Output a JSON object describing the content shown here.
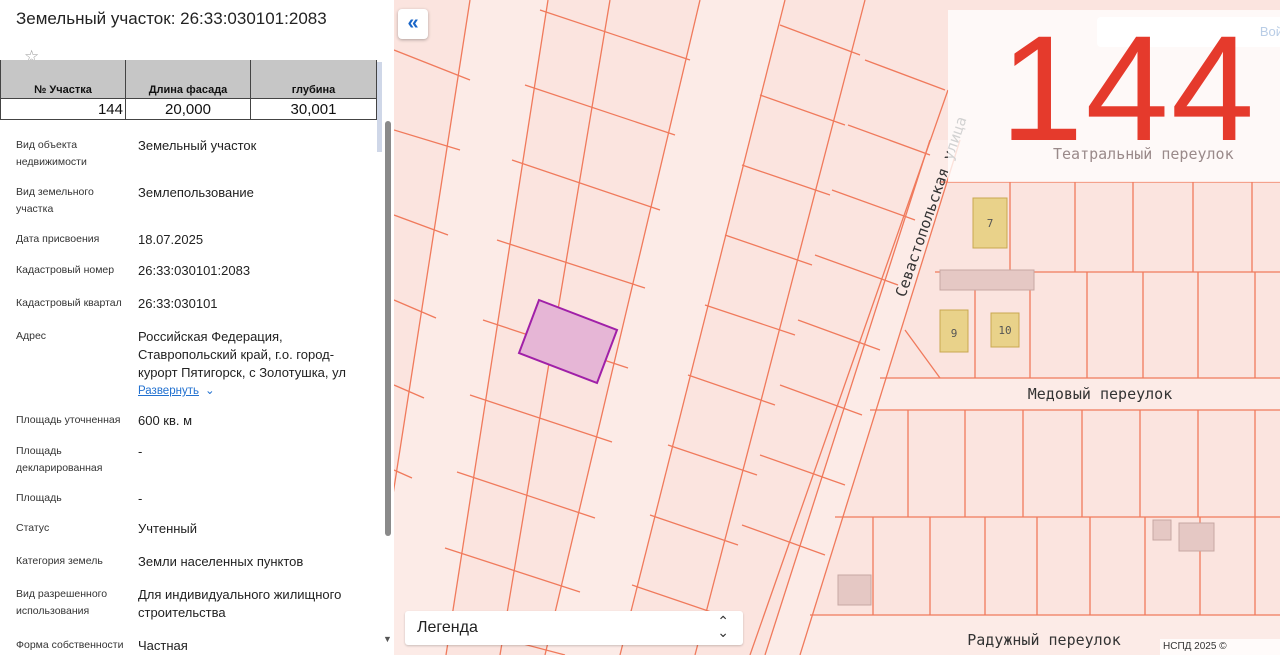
{
  "panel": {
    "title": "Земельный участок: 26:33:030101:2083",
    "favorite_icon": "star-icon",
    "overlay_table": {
      "headers": [
        "№ Участка",
        "Длина фасада",
        "глубина"
      ],
      "row": [
        "144",
        "20,000",
        "30,001"
      ]
    },
    "properties": [
      {
        "label": "Вид объекта недвижимости",
        "value": "Земельный участок"
      },
      {
        "label": "Вид земельного участка",
        "value": "Землепользование"
      },
      {
        "label": "Дата присвоения",
        "value": "18.07.2025"
      },
      {
        "label": "Кадастровый номер",
        "value": "26:33:030101:2083"
      },
      {
        "label": "Кадастровый квартал",
        "value": "26:33:030101"
      },
      {
        "label": "Адрес",
        "value": "Российская Федерация, Ставропольский край, г.о. город-курорт Пятигорск, с Золотушка, ул"
      },
      {
        "label": "Площадь уточненная",
        "value": "600 кв. м"
      },
      {
        "label": "Площадь декларированная",
        "value": "-"
      },
      {
        "label": "Площадь",
        "value": "-"
      },
      {
        "label": "Статус",
        "value": "Учтенный"
      },
      {
        "label": "Категория земель",
        "value": "Земли населенных пунктов"
      },
      {
        "label": "Вид разрешенного использования",
        "value": "Для индивидуального жилищного строительства"
      },
      {
        "label": "Форма собственности",
        "value": "Частная"
      }
    ],
    "expand_link": "Развернуть"
  },
  "map": {
    "collapse_button": "«",
    "big_number": "144",
    "login_button": "Войт",
    "streets": {
      "sevastopolskaya": "Севастопольская улица",
      "teatralny": "Театральный переулок",
      "medovy": "Медовый переулок",
      "raduzhny": "Радужный переулок"
    },
    "building_numbers": [
      "7",
      "9",
      "10"
    ],
    "legend_label": "Легенда",
    "copyright": "НСПД 2025 ©",
    "colors": {
      "map_bg": "#fbe4df",
      "parcel_line": "#f07a5c",
      "selected_parcel_fill": "#e6b6d6",
      "selected_parcel_stroke": "#a020a8",
      "building_fill": "#e9d28a",
      "big_number": "#e53a2c",
      "link": "#2271d0"
    }
  }
}
